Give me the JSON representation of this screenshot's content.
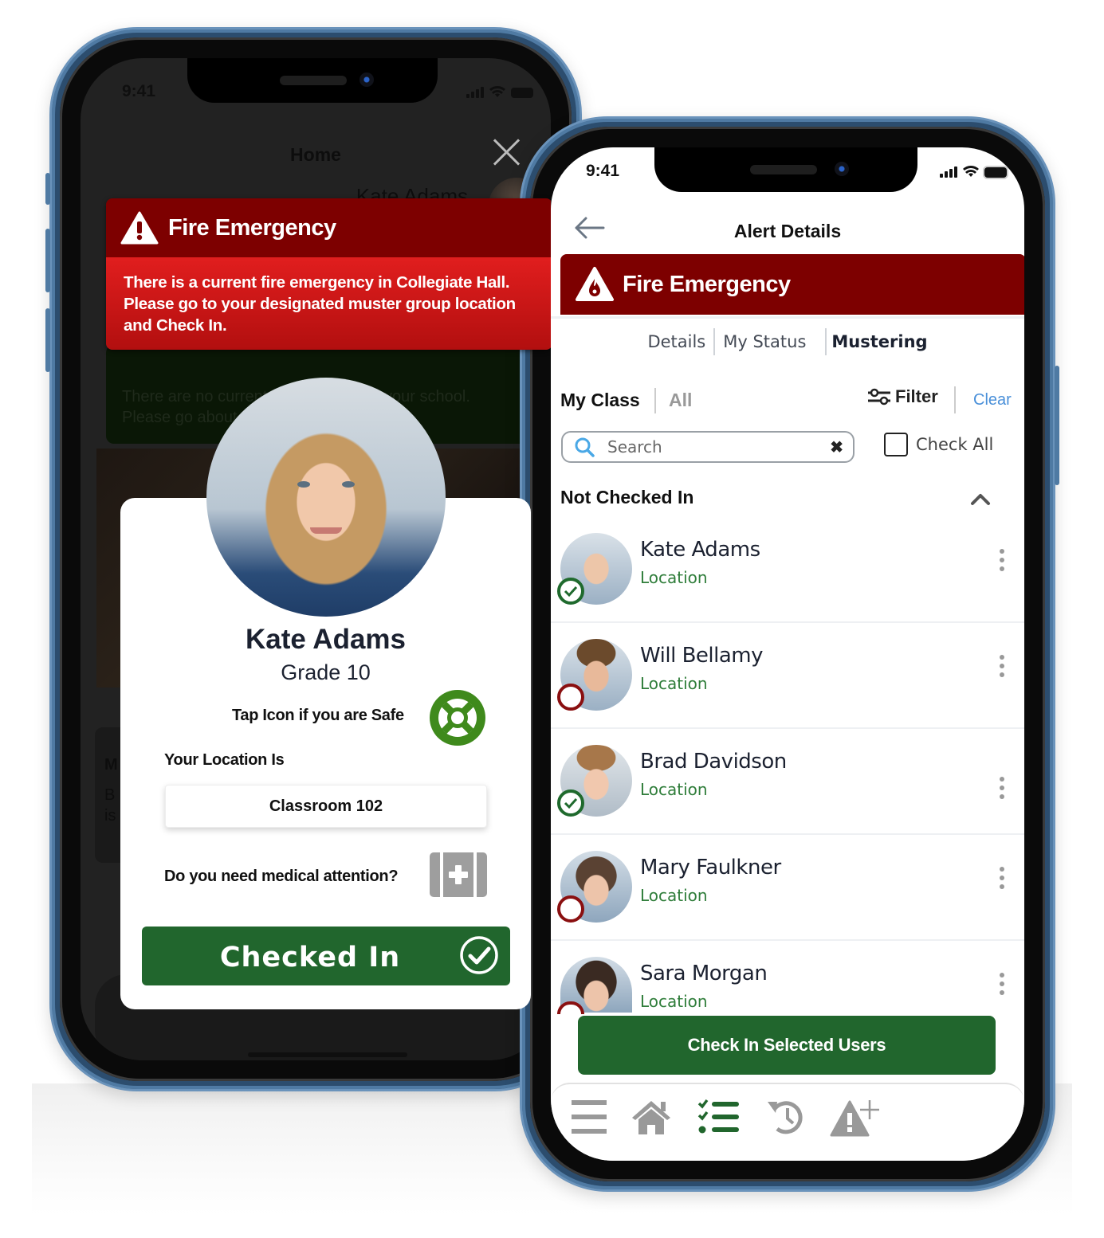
{
  "left_phone": {
    "status_bar": {
      "time": "9:41"
    },
    "background_screen": {
      "title": "Home",
      "user_name": "Kate Adams",
      "notice_text": [
        "There are no current emergencies in your school.",
        "Please go about your schedule as usual."
      ],
      "card_letters": [
        "M",
        "B",
        "is"
      ]
    },
    "alert": {
      "title": "Fire Emergency",
      "message": [
        "There is a current fire emergency in Collegiate Hall.",
        "Please go to your designated muster group location",
        "and Check In."
      ]
    },
    "checkin_card": {
      "name": "Kate Adams",
      "grade": "Grade 10",
      "safe_prompt": "Tap Icon if you are Safe",
      "location_label": "Your Location Is",
      "location_value": "Classroom 102",
      "medical_prompt": "Do you need medical attention?",
      "checked_in_label": "Checked In"
    },
    "icons": {
      "close": "close-icon",
      "safe": "lifebuoy-icon",
      "medical": "first-aid-kit-icon",
      "checked": "check-circle-icon"
    }
  },
  "right_phone": {
    "status_bar": {
      "time": "9:41"
    },
    "header": {
      "title": "Alert Details",
      "back_icon": "arrow-left-icon"
    },
    "alert": {
      "title": "Fire Emergency",
      "icon": "fire-warning-icon"
    },
    "tabs": [
      {
        "label": "Details",
        "active": false
      },
      {
        "label": "My Status",
        "active": false
      },
      {
        "label": "Mustering",
        "active": true
      }
    ],
    "scope": {
      "my_class": "My Class",
      "all": "All",
      "filter": "Filter",
      "clear": "Clear"
    },
    "search": {
      "placeholder": "Search",
      "value": ""
    },
    "check_all": {
      "label": "Check All",
      "checked": false
    },
    "section": {
      "title": "Not Checked In",
      "expanded": true
    },
    "users": [
      {
        "name": "Kate Adams",
        "location": "Location",
        "checked_in": true
      },
      {
        "name": "Will Bellamy",
        "location": "Location",
        "checked_in": false
      },
      {
        "name": "Brad Davidson",
        "location": "Location",
        "checked_in": true
      },
      {
        "name": "Mary Faulkner",
        "location": "Location",
        "checked_in": false
      },
      {
        "name": "Sara Morgan",
        "location": "Location",
        "checked_in": false
      }
    ],
    "bulk_button": "Check In Selected Users",
    "bottom_nav": [
      {
        "icon": "menu-icon",
        "active": false
      },
      {
        "icon": "home-icon",
        "active": false
      },
      {
        "icon": "checklist-icon",
        "active": true
      },
      {
        "icon": "history-icon",
        "active": false
      },
      {
        "icon": "add-alert-icon",
        "active": false
      }
    ]
  },
  "colors": {
    "alert_dark_red": "#7d0000",
    "alert_red": "#e11e1e",
    "primary_green": "#21662d",
    "location_green": "#2f7d3a",
    "unchecked_red": "#8a0f10",
    "link_blue": "#4a90d9",
    "frame_blue": "#4f7aa3"
  }
}
